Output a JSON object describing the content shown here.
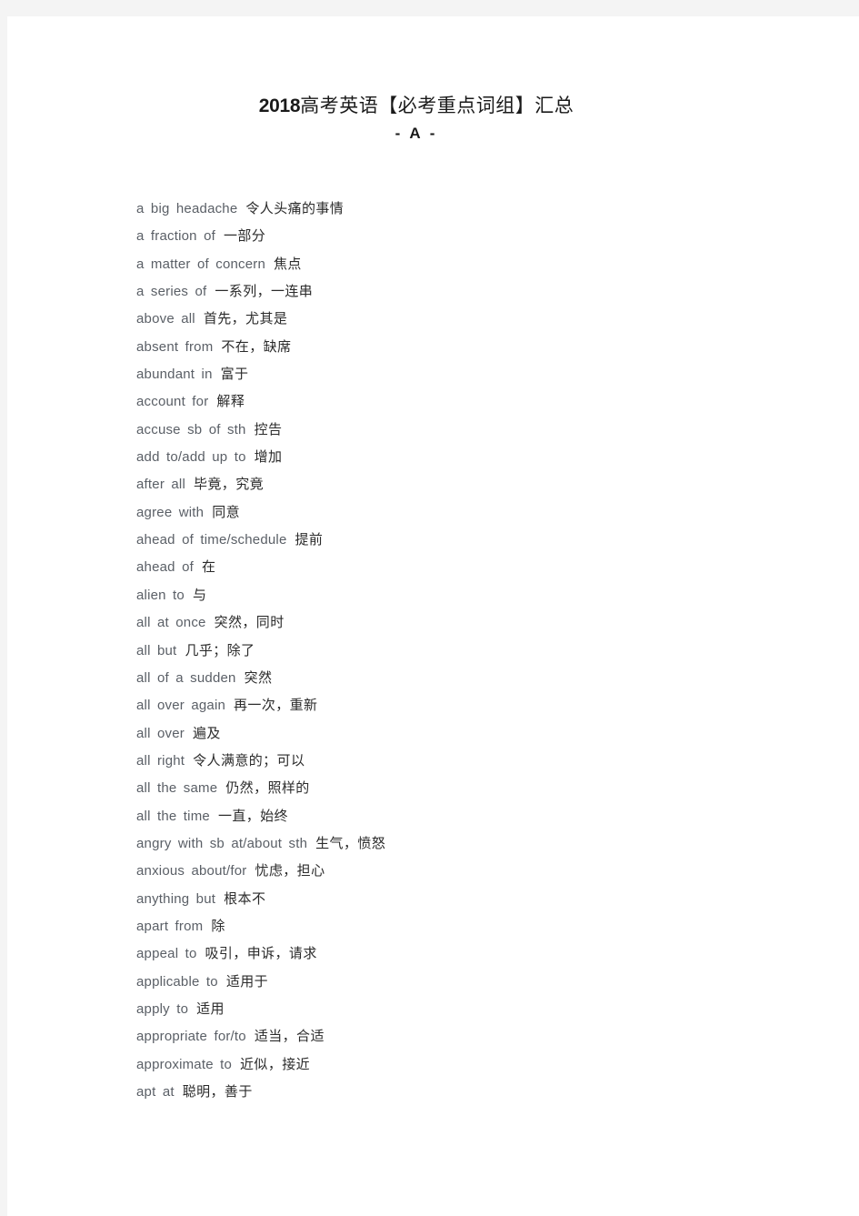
{
  "document": {
    "title_year": "2018",
    "title_cn": "高考英语【必考重点词组】汇总",
    "subtitle": "- A -"
  },
  "entries": [
    {
      "en": "a big headache",
      "cn": "令人头痛的事情"
    },
    {
      "en": "a fraction of",
      "cn": "一部分"
    },
    {
      "en": "a matter of concern",
      "cn": "焦点"
    },
    {
      "en": "a series of",
      "cn": "一系列，一连串"
    },
    {
      "en": "above all",
      "cn": "首先，尤其是"
    },
    {
      "en": "absent from",
      "cn": "不在，缺席"
    },
    {
      "en": "abundant in",
      "cn": "富于"
    },
    {
      "en": "account for",
      "cn": "解释"
    },
    {
      "en": "accuse sb of sth",
      "cn": "控告"
    },
    {
      "en": "add to/add up to",
      "cn": "增加"
    },
    {
      "en": "after all",
      "cn": "毕竟，究竟"
    },
    {
      "en": "agree with",
      "cn": "同意"
    },
    {
      "en": "ahead of time/schedule",
      "cn": "提前"
    },
    {
      "en": "ahead of",
      "cn": "在"
    },
    {
      "en": "alien to",
      "cn": "与"
    },
    {
      "en": "all at once",
      "cn": "突然，同时"
    },
    {
      "en": "all but",
      "cn": "几乎；除了"
    },
    {
      "en": "all of a sudden",
      "cn": "突然"
    },
    {
      "en": "all over again",
      "cn": "再一次，重新"
    },
    {
      "en": "all over",
      "cn": "遍及"
    },
    {
      "en": "all right",
      "cn": "令人满意的；可以"
    },
    {
      "en": "all the same",
      "cn": "仍然，照样的"
    },
    {
      "en": "all the time",
      "cn": "一直，始终"
    },
    {
      "en": "angry with sb at/about sth",
      "cn": "生气，愤怒"
    },
    {
      "en": "anxious about/for",
      "cn": "忧虑，担心"
    },
    {
      "en": "anything but",
      "cn": "根本不"
    },
    {
      "en": "apart from",
      "cn": "除"
    },
    {
      "en": "appeal to",
      "cn": "吸引，申诉，请求"
    },
    {
      "en": "applicable to",
      "cn": "适用于"
    },
    {
      "en": "apply to",
      "cn": "适用"
    },
    {
      "en": "appropriate for/to",
      "cn": "适当，合适"
    },
    {
      "en": "approximate to",
      "cn": "近似，接近"
    },
    {
      "en": "apt at",
      "cn": "聪明，善于"
    }
  ]
}
